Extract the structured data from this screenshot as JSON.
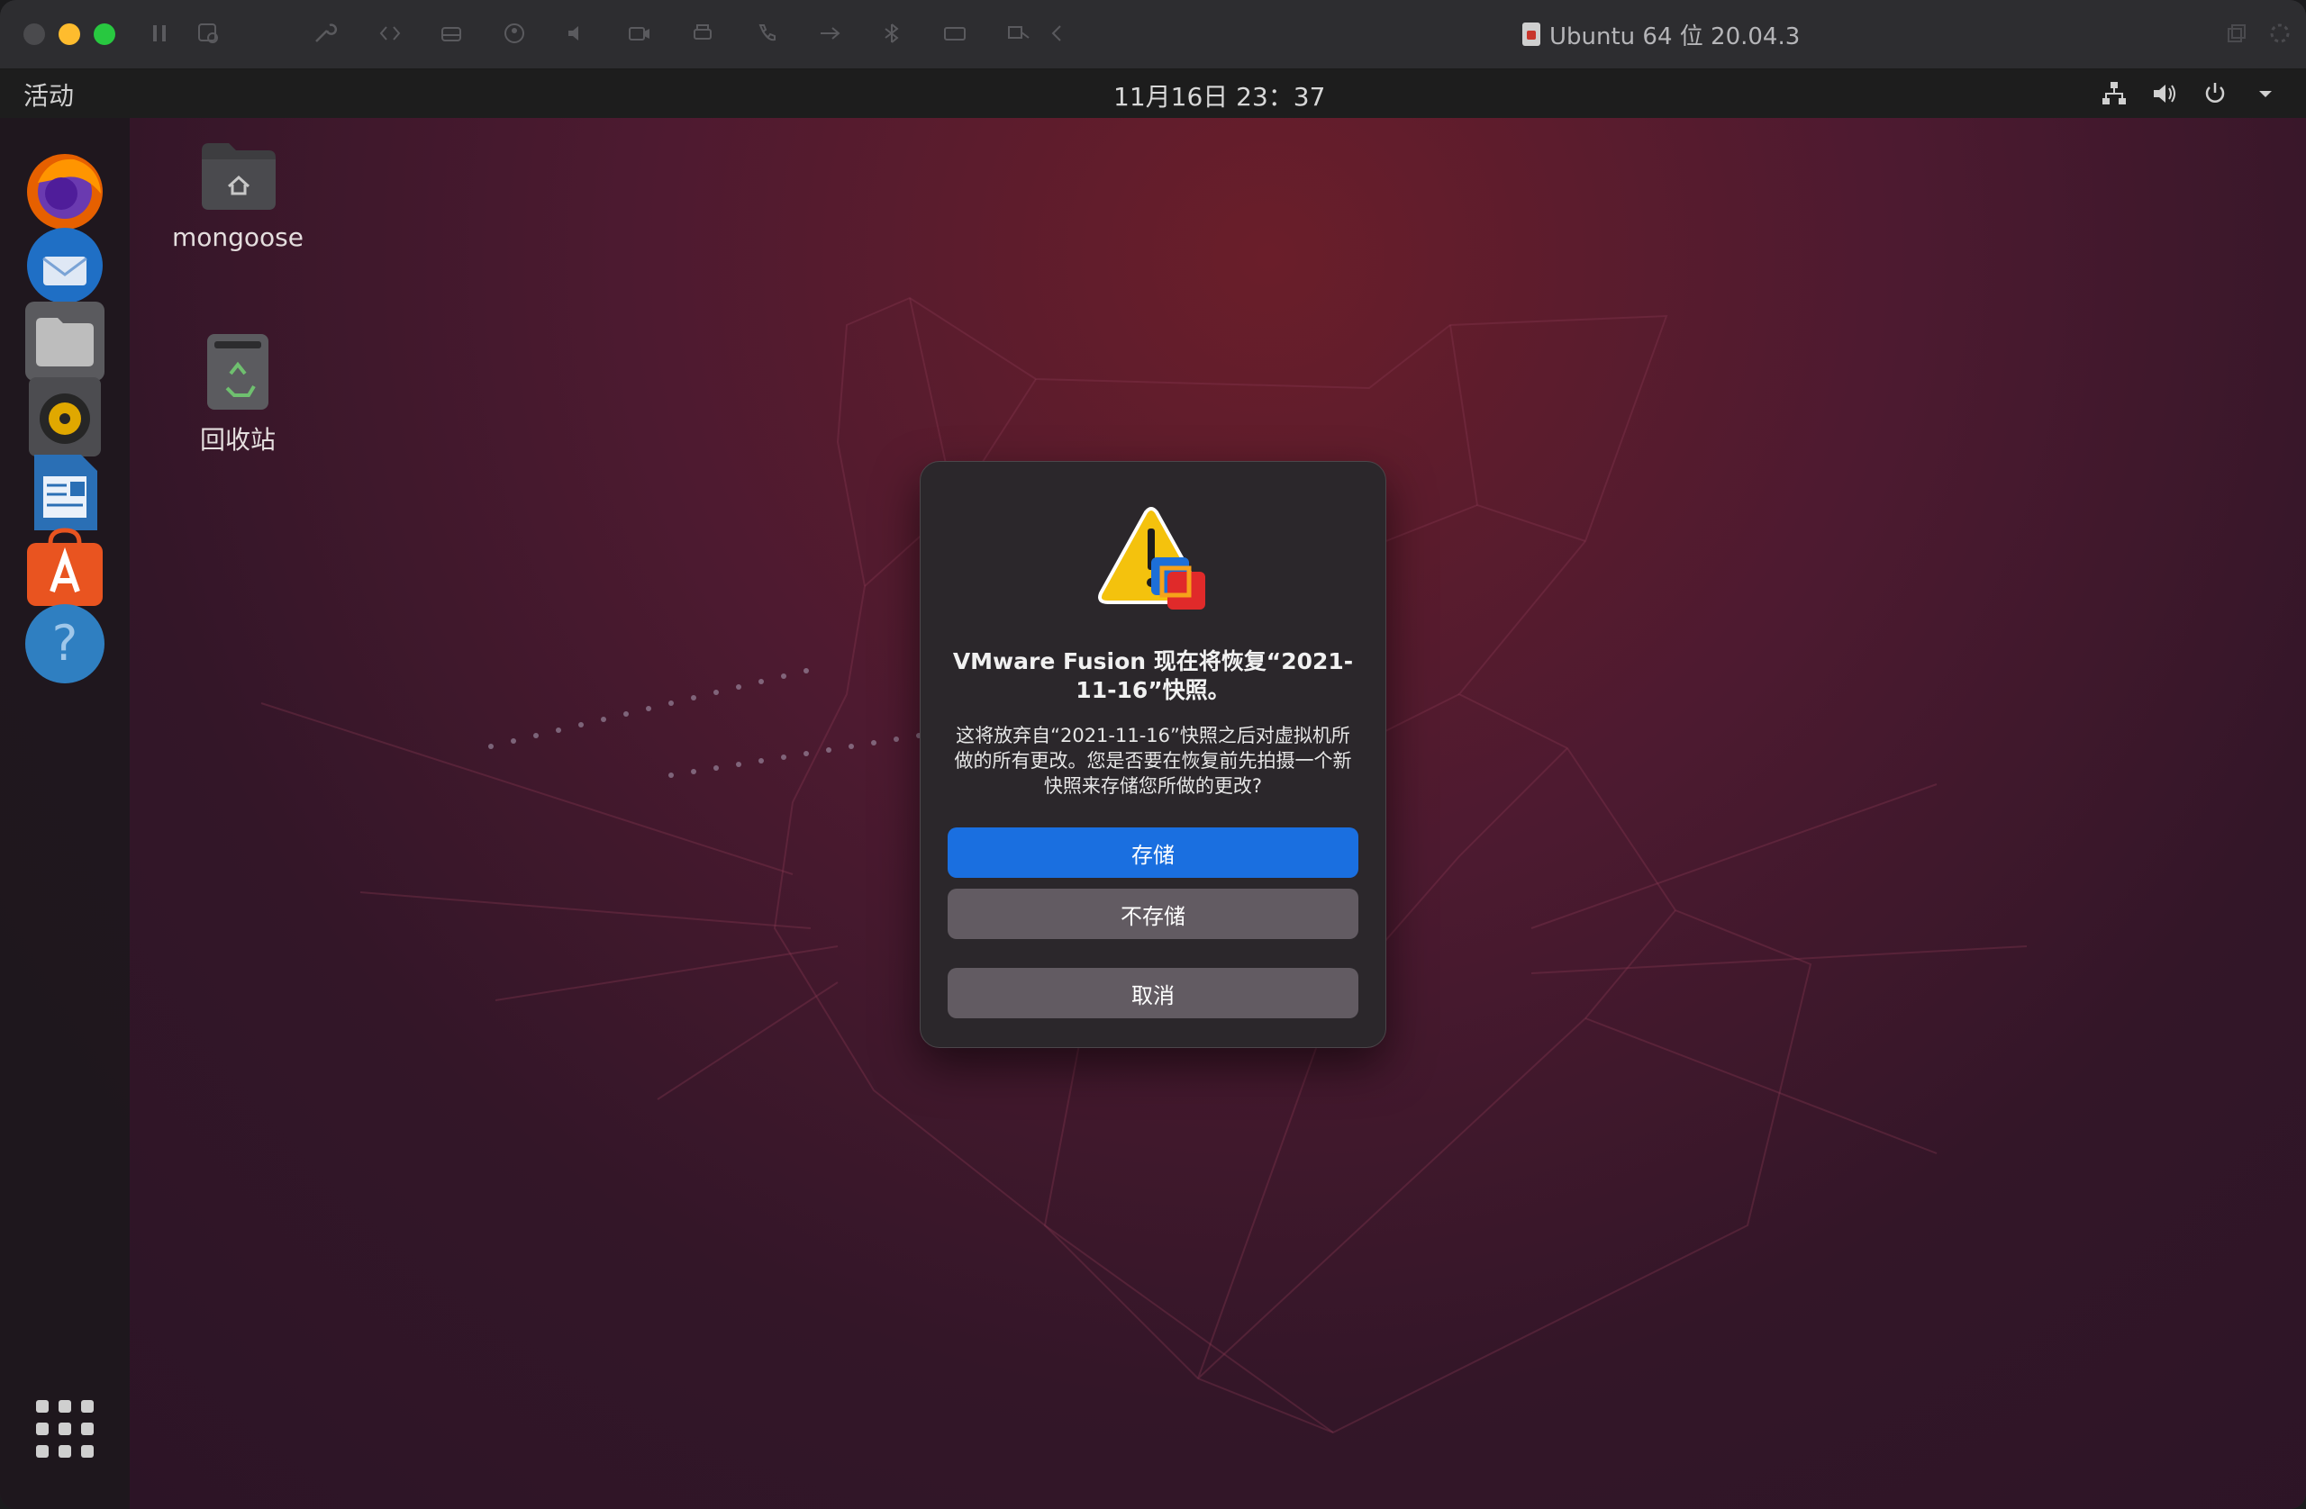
{
  "window": {
    "title": "Ubuntu 64 位 20.04.3"
  },
  "guest_topbar": {
    "activities": "活动",
    "clock": "11月16日  23：37"
  },
  "desktop": {
    "icons": [
      {
        "label": "mongoose",
        "icon": "home-folder-icon"
      },
      {
        "label": "回收站",
        "icon": "trash-icon"
      }
    ]
  },
  "dock": {
    "items": [
      "firefox-icon",
      "thunderbird-icon",
      "files-icon",
      "rhythmbox-icon",
      "libreoffice-writer-icon",
      "ubuntu-software-icon",
      "help-icon",
      "show-apps-icon"
    ]
  },
  "dialog": {
    "icon": "vmware-warning-icon",
    "title": "VMware Fusion 现在将恢复“2021-11-16”快照。",
    "message": "这将放弃自“2021-11-16”快照之后对虚拟机所做的所有更改。您是否要在恢复前先拍摄一个新快照来存储您所做的更改?",
    "buttons": {
      "save": "存储",
      "dont_save": "不存储",
      "cancel": "取消"
    }
  },
  "colors": {
    "accent": "#1a6fe0",
    "desktop_top": "#6a1e2a",
    "desktop_bottom": "#2b1426"
  }
}
